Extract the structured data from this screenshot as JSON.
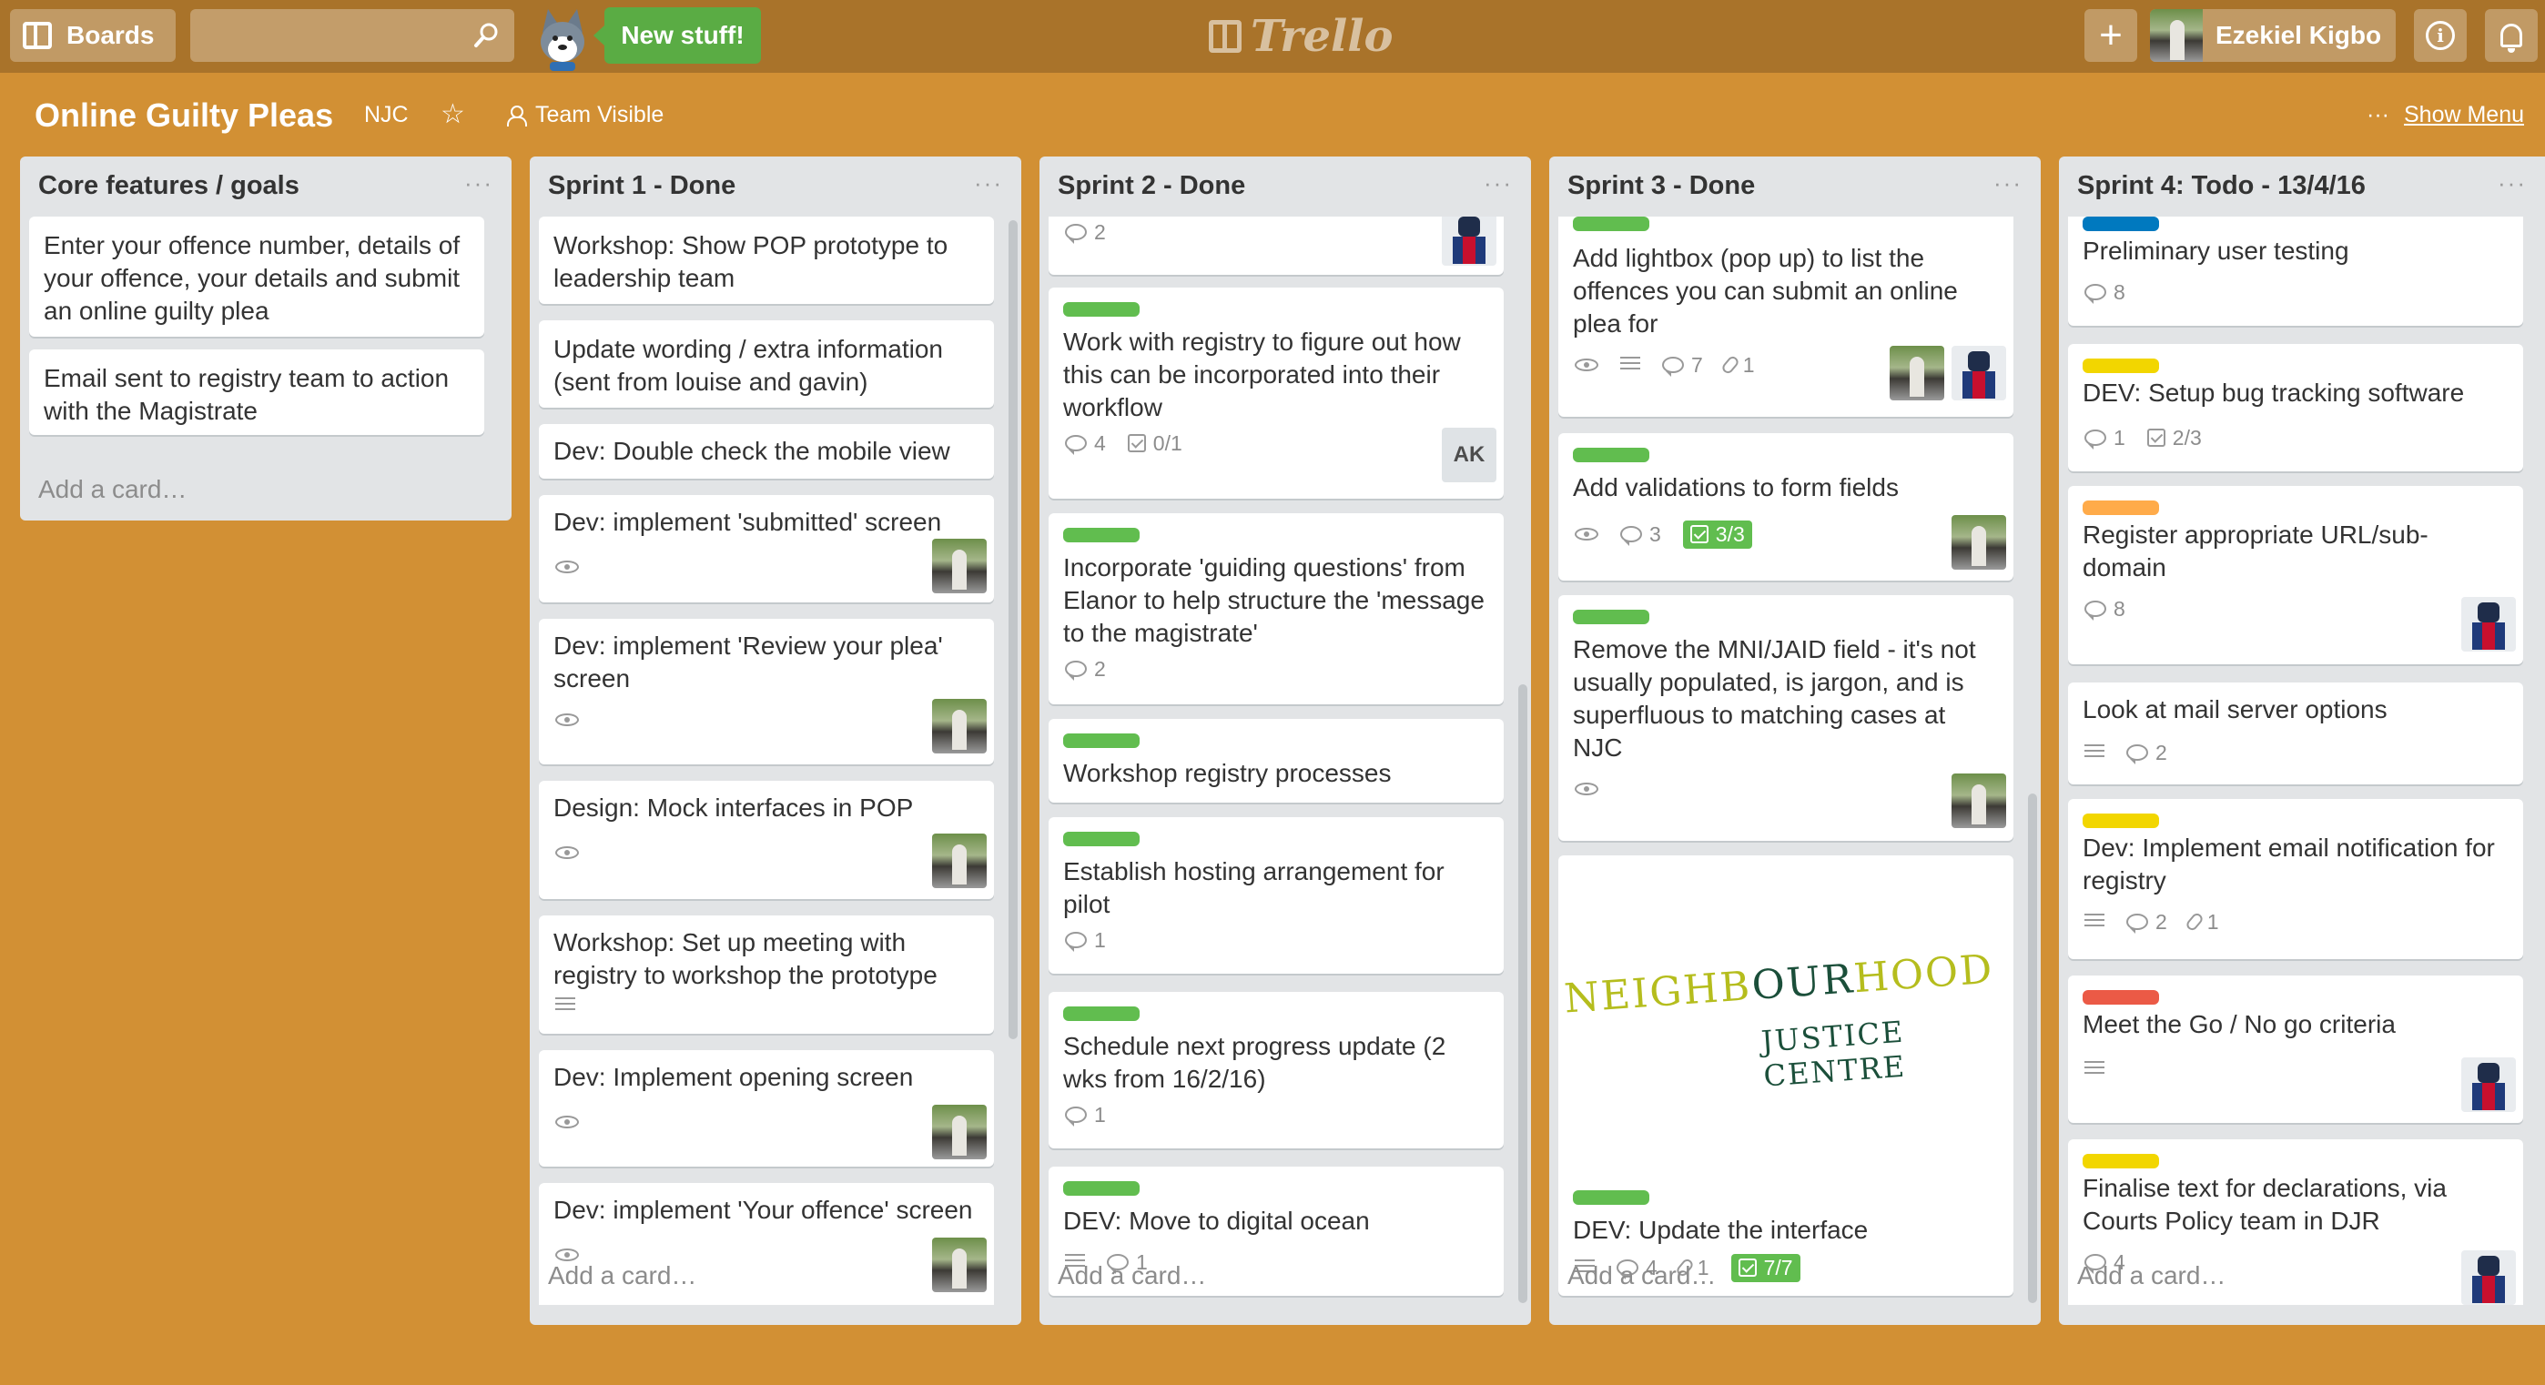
{
  "header": {
    "boards_label": "Boards",
    "search_placeholder": "",
    "new_stuff_label": "New stuff!",
    "logo_text": "Trello",
    "add_label": "+",
    "user_name": "Ezekiel Kigbo",
    "info_label": "i"
  },
  "board": {
    "title": "Online Guilty Pleas",
    "team": "NJC",
    "visibility": "Team Visible",
    "menu_dots": "···",
    "menu_label": "Show Menu"
  },
  "add_card_label": "Add a card…",
  "lists": [
    {
      "title": "Core features / goals",
      "cards": [
        {
          "text": "Enter your offence number, details of your offence, your details and submit an online guilty plea"
        },
        {
          "text": "Email sent to registry team to action with the Magistrate"
        }
      ]
    },
    {
      "title": "Sprint 1 - Done",
      "cards": [
        {
          "text": "Workshop: Show POP prototype to leadership team"
        },
        {
          "text": "Update wording / extra information (sent from louise and gavin)"
        },
        {
          "text": "Dev: Double check the mobile view"
        },
        {
          "text": "Dev: implement 'submitted' screen",
          "badges": [
            "watch"
          ],
          "avatar": "photo"
        },
        {
          "text": "Dev: implement 'Review your plea' screen",
          "badges": [
            "watch"
          ],
          "avatar": "photo"
        },
        {
          "text": "Design: Mock interfaces in POP",
          "badges": [
            "watch"
          ],
          "avatar": "photo"
        },
        {
          "text": "Workshop: Set up meeting with registry to workshop the prototype",
          "badges": [
            "description"
          ]
        },
        {
          "text": "Dev: Implement opening screen",
          "badges": [
            "watch"
          ],
          "avatar": "photo"
        },
        {
          "text": "Dev: implement 'Your offence' screen",
          "badges": [
            "watch"
          ],
          "avatar": "photo"
        }
      ]
    },
    {
      "title": "Sprint 2 - Done",
      "cards": [
        {
          "text": "",
          "comments": "2",
          "avatar": "lego"
        },
        {
          "text": "Work with registry to figure out how this can be incorporated into their workflow",
          "label": "#61bd4f",
          "comments": "4",
          "checklist": "0/1",
          "initials": "AK"
        },
        {
          "text": "Incorporate 'guiding questions' from Elanor to help structure the 'message to the magistrate'",
          "label": "#61bd4f",
          "comments": "2"
        },
        {
          "text": "Workshop registry processes",
          "label": "#61bd4f"
        },
        {
          "text": "Establish hosting arrangement for pilot",
          "label": "#61bd4f",
          "comments": "1"
        },
        {
          "text": "Schedule next progress update (2 wks from 16/2/16)",
          "label": "#61bd4f",
          "comments": "1"
        },
        {
          "text": "DEV: Move to digital ocean",
          "label": "#61bd4f",
          "comments": "1"
        }
      ]
    },
    {
      "title": "Sprint 3 - Done",
      "cards": [
        {
          "text": "Add lightbox (pop up) to list the offences you can submit an online plea for",
          "label": "#61bd4f",
          "comments": "7",
          "attachments": "1"
        },
        {
          "text": "Add validations to form fields",
          "label": "#61bd4f",
          "comments": "3",
          "checklist": "3/3"
        },
        {
          "text": "Remove the MNI/JAID field - it's not usually populated, is jargon, and is superfluous to matching cases at NJC",
          "label": "#61bd4f"
        },
        {
          "text": "DEV: Update the interface",
          "label": "#61bd4f",
          "comments": "4",
          "attachments": "1",
          "checklist": "7/7",
          "cover": {
            "line1a": "NEIGHB",
            "line1b": "OUR",
            "line1c": "HOOD",
            "line2": "JUSTICE CENTRE"
          }
        }
      ]
    },
    {
      "title": "Sprint 4: Todo - 13/4/16",
      "cards": [
        {
          "text": "Preliminary user testing",
          "label": "#0079bf",
          "comments": "8"
        },
        {
          "text": "DEV: Setup bug tracking software",
          "label": "#f2d600",
          "comments": "1",
          "checklist": "2/3"
        },
        {
          "text": "Register appropriate URL/sub-domain",
          "label": "#ffab4a",
          "comments": "8"
        },
        {
          "text": "Look at mail server options",
          "comments": "2"
        },
        {
          "text": "Dev: Implement email notification for registry",
          "label": "#f2d600",
          "comments": "2",
          "attachments": "1"
        },
        {
          "text": "Meet the Go / No go criteria",
          "label": "#eb5a46"
        },
        {
          "text": "Finalise text for declarations, via Courts Policy team in DJR",
          "label": "#f2d600",
          "comments": "4"
        }
      ]
    }
  ]
}
